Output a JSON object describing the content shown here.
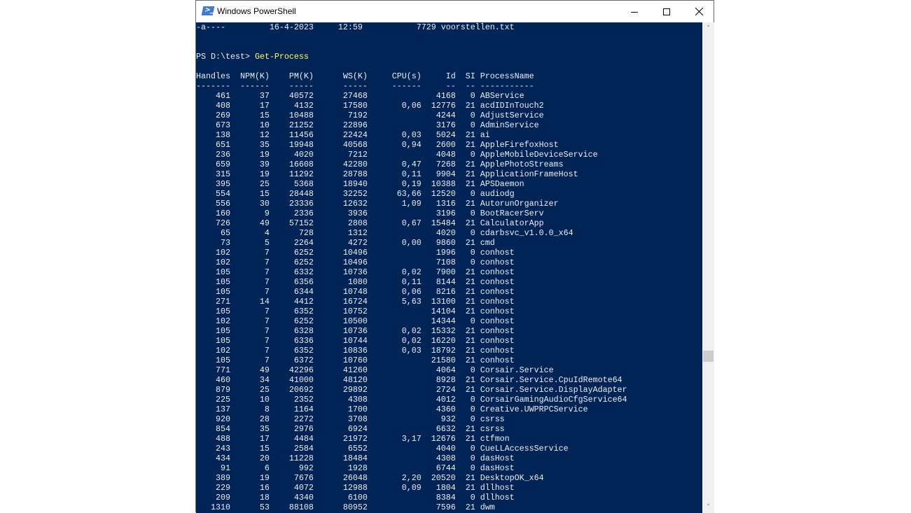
{
  "window": {
    "title": "Windows PowerShell",
    "icon": "powershell-icon"
  },
  "console": {
    "file_line": {
      "mode": "-a----",
      "date": "16-4-2023",
      "time": "12:59",
      "length": "7729",
      "name": "voorstellen.txt"
    },
    "prompt": "PS D:\\test> ",
    "command": "Get-Process",
    "columns": [
      "Handles",
      "NPM(K)",
      "PM(K)",
      "WS(K)",
      "CPU(s)",
      "Id",
      "SI",
      "ProcessName"
    ],
    "rows": [
      [
        "461",
        "37",
        "40572",
        "27468",
        "",
        "4168",
        "0",
        "ABService"
      ],
      [
        "408",
        "17",
        "4132",
        "17580",
        "0,06",
        "12776",
        "21",
        "acdIDInTouch2"
      ],
      [
        "269",
        "15",
        "10488",
        "7192",
        "",
        "4244",
        "0",
        "AdjustService"
      ],
      [
        "673",
        "10",
        "21252",
        "22896",
        "",
        "3176",
        "0",
        "AdminService"
      ],
      [
        "138",
        "12",
        "11456",
        "22424",
        "0,03",
        "5024",
        "21",
        "ai"
      ],
      [
        "651",
        "35",
        "19948",
        "40568",
        "0,94",
        "2600",
        "21",
        "AppleFirefoxHost"
      ],
      [
        "236",
        "19",
        "4020",
        "7212",
        "",
        "4048",
        "0",
        "AppleMobileDeviceService"
      ],
      [
        "659",
        "39",
        "16608",
        "42280",
        "0,47",
        "7268",
        "21",
        "ApplePhotoStreams"
      ],
      [
        "315",
        "19",
        "11292",
        "28788",
        "0,11",
        "9904",
        "21",
        "ApplicationFrameHost"
      ],
      [
        "395",
        "25",
        "5368",
        "18940",
        "0,19",
        "10388",
        "21",
        "APSDaemon"
      ],
      [
        "554",
        "15",
        "28448",
        "32252",
        "63,66",
        "12520",
        "0",
        "audiodg"
      ],
      [
        "556",
        "30",
        "23336",
        "12632",
        "1,09",
        "1316",
        "21",
        "AutorunOrganizer"
      ],
      [
        "160",
        "9",
        "2336",
        "3936",
        "",
        "3196",
        "0",
        "BootRacerServ"
      ],
      [
        "726",
        "49",
        "57152",
        "2808",
        "0,67",
        "15484",
        "21",
        "CalculatorApp"
      ],
      [
        "65",
        "4",
        "728",
        "1312",
        "",
        "4020",
        "0",
        "cdarbsvc_v1.0.0_x64"
      ],
      [
        "73",
        "5",
        "2264",
        "4272",
        "0,00",
        "9860",
        "21",
        "cmd"
      ],
      [
        "102",
        "7",
        "6252",
        "10496",
        "",
        "1996",
        "0",
        "conhost"
      ],
      [
        "102",
        "7",
        "6252",
        "10496",
        "",
        "7108",
        "0",
        "conhost"
      ],
      [
        "105",
        "7",
        "6332",
        "10736",
        "0,02",
        "7900",
        "21",
        "conhost"
      ],
      [
        "105",
        "7",
        "6356",
        "1080",
        "0,11",
        "8144",
        "21",
        "conhost"
      ],
      [
        "105",
        "7",
        "6344",
        "10748",
        "0,06",
        "8216",
        "21",
        "conhost"
      ],
      [
        "271",
        "14",
        "4412",
        "16724",
        "5,63",
        "13100",
        "21",
        "conhost"
      ],
      [
        "105",
        "7",
        "6352",
        "10752",
        "",
        "14104",
        "21",
        "conhost"
      ],
      [
        "102",
        "7",
        "6252",
        "10500",
        "",
        "14344",
        "0",
        "conhost"
      ],
      [
        "105",
        "7",
        "6328",
        "10736",
        "0,02",
        "15332",
        "21",
        "conhost"
      ],
      [
        "105",
        "7",
        "6336",
        "10744",
        "0,02",
        "16220",
        "21",
        "conhost"
      ],
      [
        "102",
        "7",
        "6352",
        "10836",
        "0,03",
        "18792",
        "21",
        "conhost"
      ],
      [
        "105",
        "7",
        "6372",
        "10760",
        "",
        "21580",
        "21",
        "conhost"
      ],
      [
        "771",
        "49",
        "42296",
        "41260",
        "",
        "4064",
        "0",
        "Corsair.Service"
      ],
      [
        "460",
        "34",
        "41000",
        "48120",
        "",
        "8928",
        "21",
        "Corsair.Service.CpuIdRemote64"
      ],
      [
        "879",
        "25",
        "20692",
        "29892",
        "",
        "2724",
        "21",
        "Corsair.Service.DisplayAdapter"
      ],
      [
        "225",
        "10",
        "2352",
        "4308",
        "",
        "4012",
        "0",
        "CorsairGamingAudioCfgService64"
      ],
      [
        "137",
        "8",
        "1164",
        "1700",
        "",
        "4360",
        "0",
        "Creative.UWPRPCService"
      ],
      [
        "920",
        "28",
        "2272",
        "3708",
        "",
        "932",
        "0",
        "csrss"
      ],
      [
        "854",
        "35",
        "2976",
        "6924",
        "",
        "6632",
        "21",
        "csrss"
      ],
      [
        "488",
        "17",
        "4484",
        "21972",
        "3,17",
        "12676",
        "21",
        "ctfmon"
      ],
      [
        "243",
        "15",
        "2584",
        "6552",
        "",
        "4040",
        "0",
        "CueLLAccessService"
      ],
      [
        "434",
        "20",
        "11228",
        "18484",
        "",
        "4308",
        "0",
        "dasHost"
      ],
      [
        "91",
        "6",
        "992",
        "1928",
        "",
        "6744",
        "0",
        "dasHost"
      ],
      [
        "389",
        "19",
        "7676",
        "26048",
        "2,20",
        "20520",
        "21",
        "DesktopOK_x64"
      ],
      [
        "229",
        "16",
        "4072",
        "12988",
        "0,09",
        "1804",
        "21",
        "dllhost"
      ],
      [
        "209",
        "18",
        "4340",
        "6100",
        "",
        "8384",
        "0",
        "dllhost"
      ],
      [
        "1310",
        "53",
        "88108",
        "80952",
        "",
        "7596",
        "21",
        "dwm"
      ]
    ]
  },
  "colors": {
    "console_bg": "#012456",
    "console_fg": "#eeedf0",
    "command": "#ffff60"
  }
}
